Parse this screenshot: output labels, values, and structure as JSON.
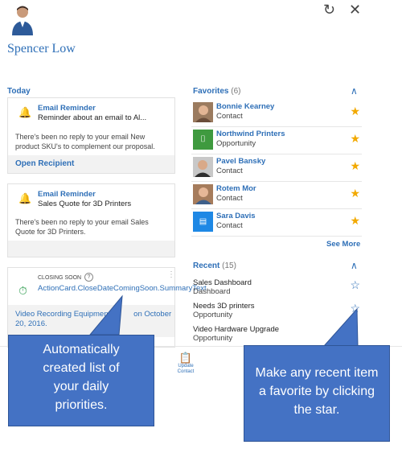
{
  "header": {
    "user_name": "Spencer Low",
    "refresh_icon": "refresh-icon",
    "close_icon": "close-icon"
  },
  "today": {
    "label": "Today",
    "cards": [
      {
        "title": "Email Reminder",
        "subtitle": "Reminder about an email to Al...",
        "body": "There's been no reply to your email New product SKU's to complement our proposal.",
        "action": "Open Recipient"
      },
      {
        "title": "Email Reminder",
        "subtitle": "Sales Quote for 3D Printers",
        "body": "There's been no reply to your email Sales Quote for 3D Printers."
      },
      {
        "tag": "CLOSING SOON",
        "info_icon": "?",
        "summary": "ActionCard.CloseDateComingSoon.SummaryText",
        "body": "Video Recording Equipmen            on October 20, 2016."
      }
    ]
  },
  "favorites": {
    "label": "Favorites",
    "count": "(6)",
    "items": [
      {
        "name": "Bonnie Kearney",
        "type": "Contact"
      },
      {
        "name": "Northwind Printers",
        "type": "Opportunity"
      },
      {
        "name": "Pavel Bansky",
        "type": "Contact"
      },
      {
        "name": "Rotem Mor",
        "type": "Contact"
      },
      {
        "name": "Sara Davis",
        "type": "Contact"
      }
    ],
    "see_more": "See More"
  },
  "recent": {
    "label": "Recent",
    "count": "(15)",
    "items": [
      {
        "name": "Sales Dashboard",
        "type": "Dashboard"
      },
      {
        "name": "Needs 3D printers",
        "type": "Opportunity"
      },
      {
        "name": "Video Hardware Upgrade",
        "type": "Opportunity"
      }
    ]
  },
  "bottom_bar": {
    "update_label_1": "Update",
    "update_label_2": "Contact"
  },
  "callouts": {
    "left": "Automatically created list of your daily priorities.",
    "right": "Make any recent item a favorite by clicking the star."
  },
  "colors": {
    "accent": "#2e6fb7",
    "star": "#f2a900",
    "callout": "#4472c4"
  }
}
